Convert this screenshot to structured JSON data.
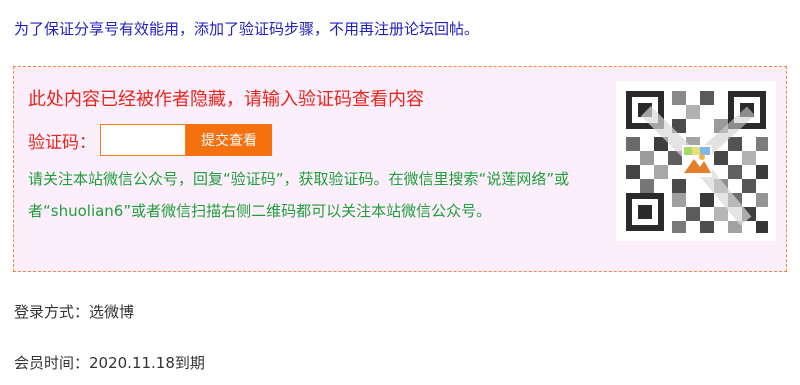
{
  "notice": {
    "text": "为了保证分享号有效能用，添加了验证码步骤，不用再注册论坛回帖。"
  },
  "hidden_box": {
    "title": "此处内容已经被作者隐藏，请输入验证码查看内容",
    "code_label": "验证码：",
    "code_input_value": "",
    "submit_label": "提交查看",
    "instructions": "请关注本站微信公众号，回复“验证码”，获取验证码。在微信里搜索“说莲网络”或者“shuolian6”或者微信扫描右侧二维码都可以关注本站微信公众号。",
    "qr_icon": "qr-code-icon"
  },
  "login": {
    "text": "登录方式：选微博"
  },
  "membership": {
    "text": "会员时间：2020.11.18到期"
  },
  "colors": {
    "notice_text": "#1f1fbf",
    "title_text": "#e8251d",
    "instructions_text": "#1f9e3c",
    "button_bg": "#f5700f",
    "box_bg": "#fdeefb",
    "box_border": "#f08a3c"
  }
}
